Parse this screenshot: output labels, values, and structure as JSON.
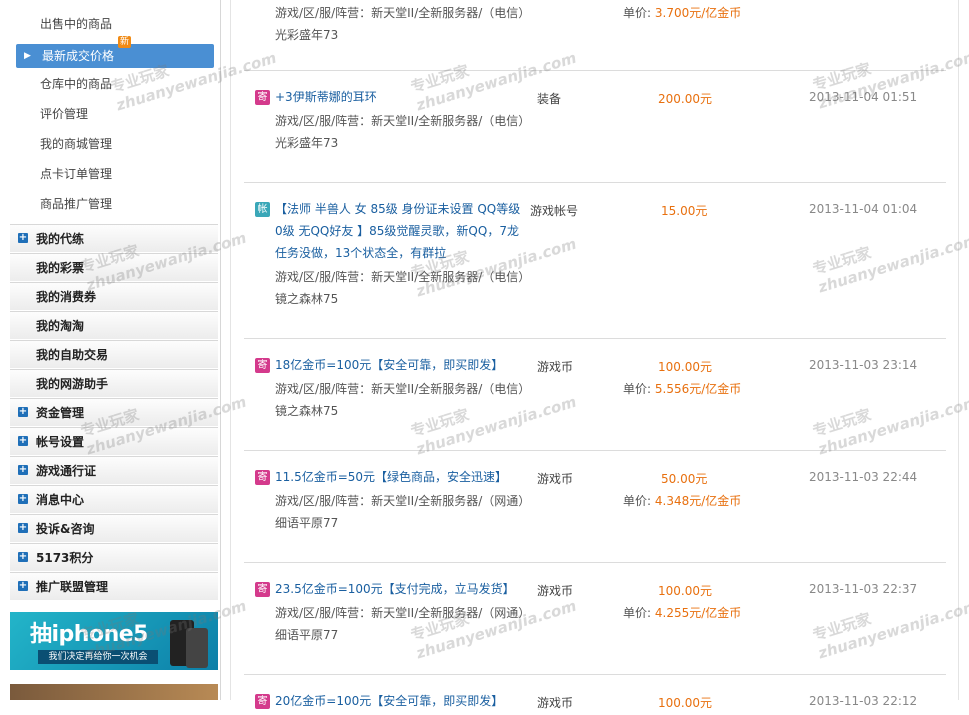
{
  "sidebar": {
    "subitems": [
      {
        "label": "出售中的商品",
        "active": false
      },
      {
        "label": "最新成交价格",
        "active": true,
        "badge": "新"
      },
      {
        "label": "仓库中的商品",
        "active": false
      },
      {
        "label": "评价管理",
        "active": false
      },
      {
        "label": "我的商城管理",
        "active": false
      },
      {
        "label": "点卡订单管理",
        "active": false
      },
      {
        "label": "商品推广管理",
        "active": false
      }
    ],
    "sections": [
      {
        "label": "我的代练",
        "plus": true
      },
      {
        "label": "我的彩票",
        "plus": false
      },
      {
        "label": "我的消费券",
        "plus": false
      },
      {
        "label": "我的淘淘",
        "plus": false
      },
      {
        "label": "我的自助交易",
        "plus": false
      },
      {
        "label": "我的网游助手",
        "plus": false
      },
      {
        "label": "资金管理",
        "plus": true
      },
      {
        "label": "帐号设置",
        "plus": true
      },
      {
        "label": "游戏通行证",
        "plus": true
      },
      {
        "label": "消息中心",
        "plus": true
      },
      {
        "label": "投诉&咨询",
        "plus": true
      },
      {
        "label": "5173积分",
        "plus": true
      },
      {
        "label": "推广联盟管理",
        "plus": true
      }
    ],
    "banner": {
      "title": "抽iphone5",
      "subtitle": "我们决定再给你一次机会"
    }
  },
  "watermark": {
    "cn": "专业玩家",
    "en": "zhuanyewanjia.com"
  },
  "listings": [
    {
      "tag": "",
      "tag_color": "",
      "title": "",
      "category": "",
      "price": "",
      "region": "游戏/区/服/阵营：新天堂II/全新服务器/（电信）",
      "server": "光彩盛年73",
      "unit_label": "单价:",
      "unit_price": "3.700元/亿金币",
      "time": ""
    },
    {
      "tag": "寄",
      "tag_color": "pink",
      "title": "+3伊斯蒂娜的耳环",
      "category": "装备",
      "price": "200.00元",
      "region": "游戏/区/服/阵营：新天堂II/全新服务器/（电信）",
      "server": "光彩盛年73",
      "unit_label": "",
      "unit_price": "",
      "time": "2013-11-04 01:51"
    },
    {
      "tag": "帐",
      "tag_color": "teal",
      "title": "【法师 半兽人 女 85级 身份证未设置 QQ等级0级 无QQ好友 】85级觉醒灵歌，新QQ，7龙任务没做，13个状态全，有群拉",
      "category": "游戏帐号",
      "price": "15.00元",
      "region": "游戏/区/服/阵营：新天堂II/全新服务器/（电信）",
      "server": "镜之森林75",
      "unit_label": "",
      "unit_price": "",
      "time": "2013-11-04 01:04"
    },
    {
      "tag": "寄",
      "tag_color": "pink",
      "title": "18亿金币=100元【安全可靠，即买即发】",
      "category": "游戏币",
      "price": "100.00元",
      "region": "游戏/区/服/阵营：新天堂II/全新服务器/（电信）",
      "server": "镜之森林75",
      "unit_label": "单价:",
      "unit_price": "5.556元/亿金币",
      "time": "2013-11-03 23:14"
    },
    {
      "tag": "寄",
      "tag_color": "pink",
      "title": "11.5亿金币=50元【绿色商品，安全迅速】",
      "category": "游戏币",
      "price": "50.00元",
      "region": "游戏/区/服/阵营：新天堂II/全新服务器/（网通）",
      "server": "细语平原77",
      "unit_label": "单价:",
      "unit_price": "4.348元/亿金币",
      "time": "2013-11-03 22:44"
    },
    {
      "tag": "寄",
      "tag_color": "pink",
      "title": "23.5亿金币=100元【支付完成，立马发货】",
      "category": "游戏币",
      "price": "100.00元",
      "region": "游戏/区/服/阵营：新天堂II/全新服务器/（网通）",
      "server": "细语平原77",
      "unit_label": "单价:",
      "unit_price": "4.255元/亿金币",
      "time": "2013-11-03 22:37"
    },
    {
      "tag": "寄",
      "tag_color": "pink",
      "title": "20亿金币=100元【安全可靠，即买即发】",
      "category": "游戏币",
      "price": "100.00元",
      "region": "",
      "server": "",
      "unit_label": "",
      "unit_price": "",
      "time": "2013-11-03 22:12"
    }
  ]
}
